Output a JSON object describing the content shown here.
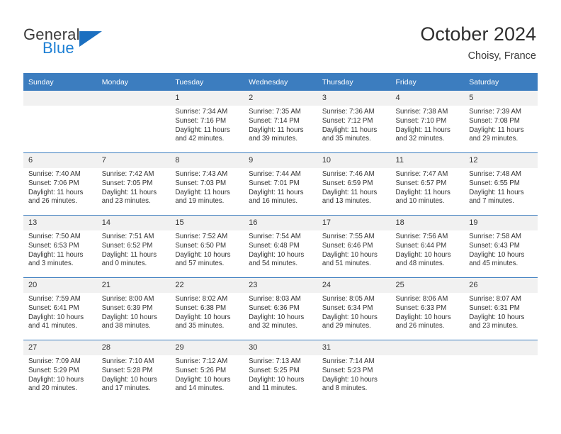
{
  "brand": {
    "name_part1": "General",
    "name_part2": "Blue",
    "accent_color": "#1b6fc0",
    "logo_icon": "triangle-flag-icon"
  },
  "header": {
    "title": "October 2024",
    "subtitle": "Choisy, France"
  },
  "theme": {
    "header_bg": "#3c7dbf",
    "daynum_bg": "#f1f1f1",
    "text_color": "#333333"
  },
  "calendar": {
    "weekday_headers": [
      "Sunday",
      "Monday",
      "Tuesday",
      "Wednesday",
      "Thursday",
      "Friday",
      "Saturday"
    ],
    "labels": {
      "sunrise": "Sunrise:",
      "sunset": "Sunset:",
      "daylight": "Daylight:"
    },
    "weeks": [
      [
        {
          "day": "",
          "blank": true
        },
        {
          "day": "",
          "blank": true
        },
        {
          "day": "1",
          "sunrise": "Sunrise: 7:34 AM",
          "sunset": "Sunset: 7:16 PM",
          "daylight": "Daylight: 11 hours and 42 minutes."
        },
        {
          "day": "2",
          "sunrise": "Sunrise: 7:35 AM",
          "sunset": "Sunset: 7:14 PM",
          "daylight": "Daylight: 11 hours and 39 minutes."
        },
        {
          "day": "3",
          "sunrise": "Sunrise: 7:36 AM",
          "sunset": "Sunset: 7:12 PM",
          "daylight": "Daylight: 11 hours and 35 minutes."
        },
        {
          "day": "4",
          "sunrise": "Sunrise: 7:38 AM",
          "sunset": "Sunset: 7:10 PM",
          "daylight": "Daylight: 11 hours and 32 minutes."
        },
        {
          "day": "5",
          "sunrise": "Sunrise: 7:39 AM",
          "sunset": "Sunset: 7:08 PM",
          "daylight": "Daylight: 11 hours and 29 minutes."
        }
      ],
      [
        {
          "day": "6",
          "sunrise": "Sunrise: 7:40 AM",
          "sunset": "Sunset: 7:06 PM",
          "daylight": "Daylight: 11 hours and 26 minutes."
        },
        {
          "day": "7",
          "sunrise": "Sunrise: 7:42 AM",
          "sunset": "Sunset: 7:05 PM",
          "daylight": "Daylight: 11 hours and 23 minutes."
        },
        {
          "day": "8",
          "sunrise": "Sunrise: 7:43 AM",
          "sunset": "Sunset: 7:03 PM",
          "daylight": "Daylight: 11 hours and 19 minutes."
        },
        {
          "day": "9",
          "sunrise": "Sunrise: 7:44 AM",
          "sunset": "Sunset: 7:01 PM",
          "daylight": "Daylight: 11 hours and 16 minutes."
        },
        {
          "day": "10",
          "sunrise": "Sunrise: 7:46 AM",
          "sunset": "Sunset: 6:59 PM",
          "daylight": "Daylight: 11 hours and 13 minutes."
        },
        {
          "day": "11",
          "sunrise": "Sunrise: 7:47 AM",
          "sunset": "Sunset: 6:57 PM",
          "daylight": "Daylight: 11 hours and 10 minutes."
        },
        {
          "day": "12",
          "sunrise": "Sunrise: 7:48 AM",
          "sunset": "Sunset: 6:55 PM",
          "daylight": "Daylight: 11 hours and 7 minutes."
        }
      ],
      [
        {
          "day": "13",
          "sunrise": "Sunrise: 7:50 AM",
          "sunset": "Sunset: 6:53 PM",
          "daylight": "Daylight: 11 hours and 3 minutes."
        },
        {
          "day": "14",
          "sunrise": "Sunrise: 7:51 AM",
          "sunset": "Sunset: 6:52 PM",
          "daylight": "Daylight: 11 hours and 0 minutes."
        },
        {
          "day": "15",
          "sunrise": "Sunrise: 7:52 AM",
          "sunset": "Sunset: 6:50 PM",
          "daylight": "Daylight: 10 hours and 57 minutes."
        },
        {
          "day": "16",
          "sunrise": "Sunrise: 7:54 AM",
          "sunset": "Sunset: 6:48 PM",
          "daylight": "Daylight: 10 hours and 54 minutes."
        },
        {
          "day": "17",
          "sunrise": "Sunrise: 7:55 AM",
          "sunset": "Sunset: 6:46 PM",
          "daylight": "Daylight: 10 hours and 51 minutes."
        },
        {
          "day": "18",
          "sunrise": "Sunrise: 7:56 AM",
          "sunset": "Sunset: 6:44 PM",
          "daylight": "Daylight: 10 hours and 48 minutes."
        },
        {
          "day": "19",
          "sunrise": "Sunrise: 7:58 AM",
          "sunset": "Sunset: 6:43 PM",
          "daylight": "Daylight: 10 hours and 45 minutes."
        }
      ],
      [
        {
          "day": "20",
          "sunrise": "Sunrise: 7:59 AM",
          "sunset": "Sunset: 6:41 PM",
          "daylight": "Daylight: 10 hours and 41 minutes."
        },
        {
          "day": "21",
          "sunrise": "Sunrise: 8:00 AM",
          "sunset": "Sunset: 6:39 PM",
          "daylight": "Daylight: 10 hours and 38 minutes."
        },
        {
          "day": "22",
          "sunrise": "Sunrise: 8:02 AM",
          "sunset": "Sunset: 6:38 PM",
          "daylight": "Daylight: 10 hours and 35 minutes."
        },
        {
          "day": "23",
          "sunrise": "Sunrise: 8:03 AM",
          "sunset": "Sunset: 6:36 PM",
          "daylight": "Daylight: 10 hours and 32 minutes."
        },
        {
          "day": "24",
          "sunrise": "Sunrise: 8:05 AM",
          "sunset": "Sunset: 6:34 PM",
          "daylight": "Daylight: 10 hours and 29 minutes."
        },
        {
          "day": "25",
          "sunrise": "Sunrise: 8:06 AM",
          "sunset": "Sunset: 6:33 PM",
          "daylight": "Daylight: 10 hours and 26 minutes."
        },
        {
          "day": "26",
          "sunrise": "Sunrise: 8:07 AM",
          "sunset": "Sunset: 6:31 PM",
          "daylight": "Daylight: 10 hours and 23 minutes."
        }
      ],
      [
        {
          "day": "27",
          "sunrise": "Sunrise: 7:09 AM",
          "sunset": "Sunset: 5:29 PM",
          "daylight": "Daylight: 10 hours and 20 minutes."
        },
        {
          "day": "28",
          "sunrise": "Sunrise: 7:10 AM",
          "sunset": "Sunset: 5:28 PM",
          "daylight": "Daylight: 10 hours and 17 minutes."
        },
        {
          "day": "29",
          "sunrise": "Sunrise: 7:12 AM",
          "sunset": "Sunset: 5:26 PM",
          "daylight": "Daylight: 10 hours and 14 minutes."
        },
        {
          "day": "30",
          "sunrise": "Sunrise: 7:13 AM",
          "sunset": "Sunset: 5:25 PM",
          "daylight": "Daylight: 10 hours and 11 minutes."
        },
        {
          "day": "31",
          "sunrise": "Sunrise: 7:14 AM",
          "sunset": "Sunset: 5:23 PM",
          "daylight": "Daylight: 10 hours and 8 minutes."
        },
        {
          "day": "",
          "blank": true
        },
        {
          "day": "",
          "blank": true
        }
      ]
    ]
  }
}
